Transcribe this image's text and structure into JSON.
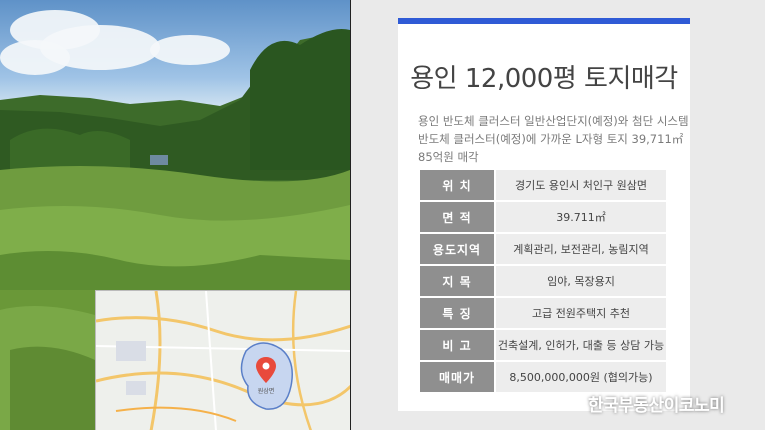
{
  "listing": {
    "title": "용인 12,000평 토지매각",
    "description": [
      "용인 반도체 클러스터 일반산업단지(예정)와 첨단 시스템",
      "반도체 클러스터(예정)에 가까운 L자형 토지 39,711㎡",
      "85억원 매각"
    ],
    "rows": [
      {
        "label": "위 치",
        "value": "경기도 용인시 처인구 원삼면"
      },
      {
        "label": "면 적",
        "value": "39.711㎡"
      },
      {
        "label": "용도지역",
        "value": "계획관리, 보전관리, 농림지역"
      },
      {
        "label": "지 목",
        "value": "임야, 목장용지"
      },
      {
        "label": "특 징",
        "value": "고급 전원주택지 추천"
      },
      {
        "label": "비 고",
        "value": "건축설계, 인허가, 대출 등 상담 가능"
      },
      {
        "label": "매매가",
        "value": "8,500,000,000원 (협의가능)"
      }
    ]
  },
  "map": {
    "pin_label": "원삼면"
  },
  "watermark": "한국부동산이코노미",
  "colors": {
    "accent": "#2f5bd6",
    "label_bg": "#8f8f8f",
    "value_bg": "#ededed",
    "pin": "#e84a3c"
  }
}
